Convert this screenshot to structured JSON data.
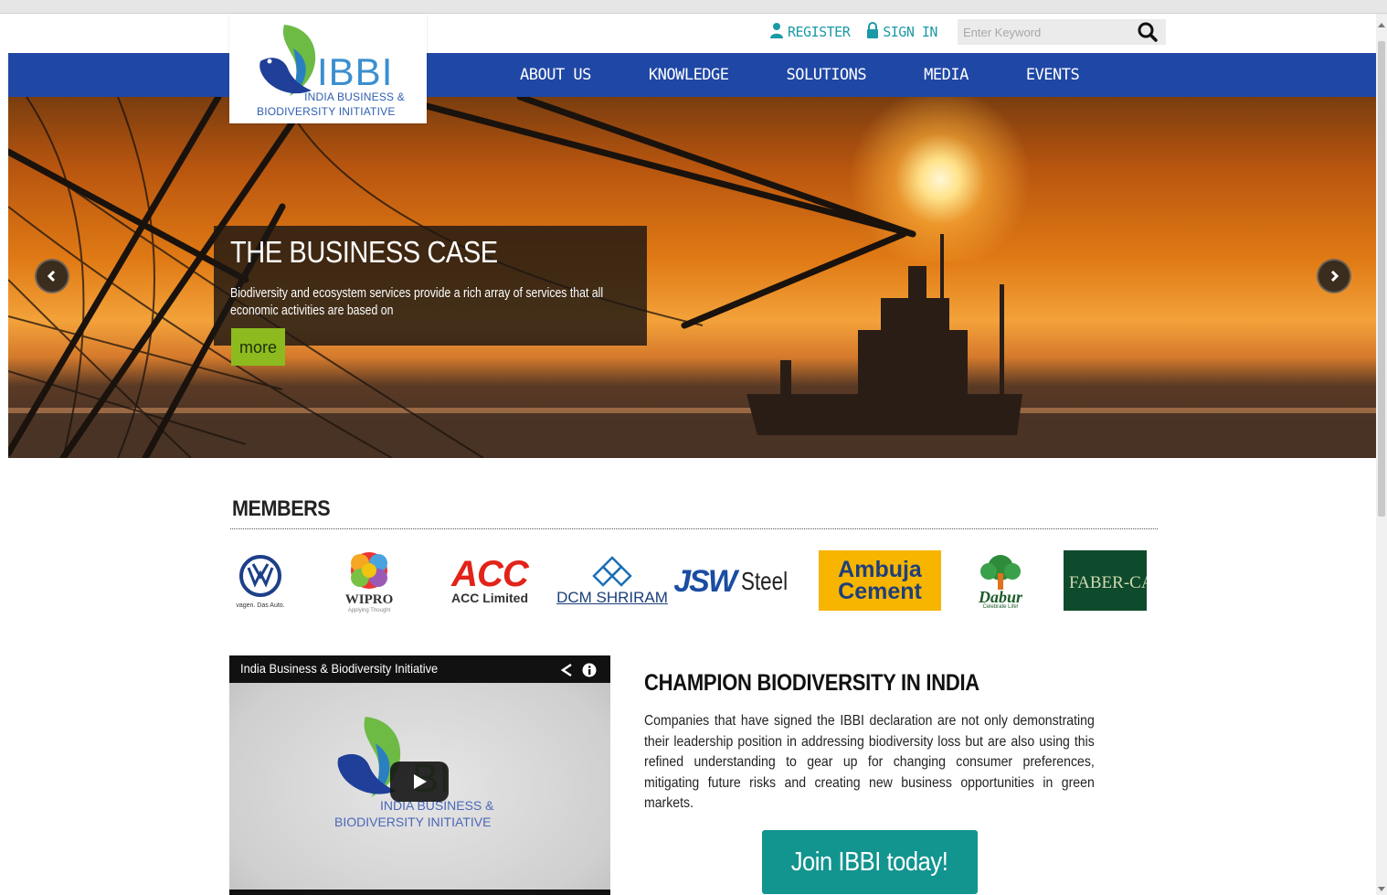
{
  "header": {
    "register_label": "REGISTER",
    "signin_label": "SIGN IN",
    "search_placeholder": "Enter Keyword",
    "logo": {
      "wordmark": "IBBI",
      "line1": "INDIA BUSINESS &",
      "line2": "BIODIVERSITY INITIATIVE"
    },
    "nav": [
      "ABOUT US",
      "KNOWLEDGE",
      "SOLUTIONS",
      "MEDIA",
      "EVENTS"
    ]
  },
  "hero": {
    "title": "THE BUSINESS CASE",
    "text": "Biodiversity and ecosystem services provide a rich array of services that all economic activities are based on",
    "more_label": "more"
  },
  "members": {
    "title": "MEMBERS",
    "logos": [
      {
        "name": "Volkswagen",
        "text": "vagen. Das Auto."
      },
      {
        "name": "Wipro",
        "text": "WIPRO",
        "sub": "Applying Thought"
      },
      {
        "name": "ACC Limited",
        "text": "ACC",
        "sub": "ACC Limited"
      },
      {
        "name": "DCM Shriram",
        "text": "DCM SHRIRAM"
      },
      {
        "name": "JSW Steel",
        "text": "JSW",
        "sub": "Steel"
      },
      {
        "name": "Ambuja Cement",
        "text": "Ambuja",
        "sub": "Cement"
      },
      {
        "name": "Dabur",
        "text": "Dabur",
        "sub": "Celebrate Life!"
      },
      {
        "name": "Faber-Castell",
        "text": "FABER-CAS"
      }
    ]
  },
  "video": {
    "title": "India Business & Biodiversity Initiative",
    "logo_word": "BI",
    "logo_line1": "INDIA BUSINESS &",
    "logo_line2": "BIODIVERSITY INITIATIVE"
  },
  "champion": {
    "title": "CHAMPION BIODIVERSITY IN INDIA",
    "text": "Companies that have signed the IBBI declaration are not only demonstrating their leadership position in addressing biodiversity loss but are also using this refined understanding to gear up for changing consumer preferences, mitigating future risks and creating new business opportunities in green markets.",
    "cta_label": "Join IBBI today!"
  },
  "colors": {
    "nav_bg": "#1f47a5",
    "accent_teal": "#12948f",
    "more_green": "#8dbb1f",
    "link_teal": "#1a9aa6"
  }
}
